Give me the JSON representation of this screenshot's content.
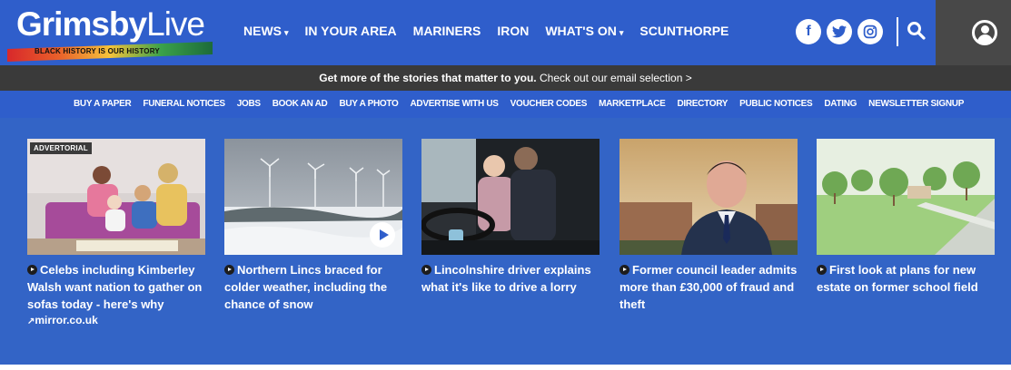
{
  "header": {
    "logo_text_bold": "Grimsby",
    "logo_text_light": "Live",
    "logo_tagline": "BLACK HISTORY IS OUR HISTORY",
    "nav": [
      {
        "label": "NEWS",
        "caret": "▾"
      },
      {
        "label": "IN YOUR AREA",
        "caret": ""
      },
      {
        "label": "MARINERS",
        "caret": ""
      },
      {
        "label": "IRON",
        "caret": ""
      },
      {
        "label": "WHAT'S ON",
        "caret": "▾"
      },
      {
        "label": "SCUNTHORPE",
        "caret": ""
      }
    ],
    "social": {
      "facebook": "f",
      "twitter": "t",
      "instagram": "◎"
    },
    "icons": {
      "search": "search-icon",
      "account": "user-icon"
    }
  },
  "promo": {
    "bold": "Get more of the stories that matter to you.",
    "rest": " Check out our email selection >"
  },
  "subnav": [
    "BUY A PAPER",
    "FUNERAL NOTICES",
    "JOBS",
    "BOOK AN AD",
    "BUY A PHOTO",
    "ADVERTISE WITH US",
    "VOUCHER CODES",
    "MARKETPLACE",
    "DIRECTORY",
    "PUBLIC NOTICES",
    "DATING",
    "NEWSLETTER SIGNUP"
  ],
  "cards": [
    {
      "badge": "ADVERTORIAL",
      "headline": "Celebs including Kimberley Walsh want nation to gather on sofas today - here's why",
      "source": "mirror.co.uk"
    },
    {
      "headline": "Northern Lincs braced for colder weather, including the chance of snow"
    },
    {
      "headline": "Lincolnshire driver explains what it's like to drive a lorry"
    },
    {
      "headline": "Former council leader admits more than £30,000 of fraud and theft"
    },
    {
      "headline": "First look at plans for new estate on former school field"
    }
  ],
  "colors": {
    "brand_blue": "#2f5ecb",
    "promo_bg": "#3a3a3a",
    "account_bg": "#484848"
  }
}
